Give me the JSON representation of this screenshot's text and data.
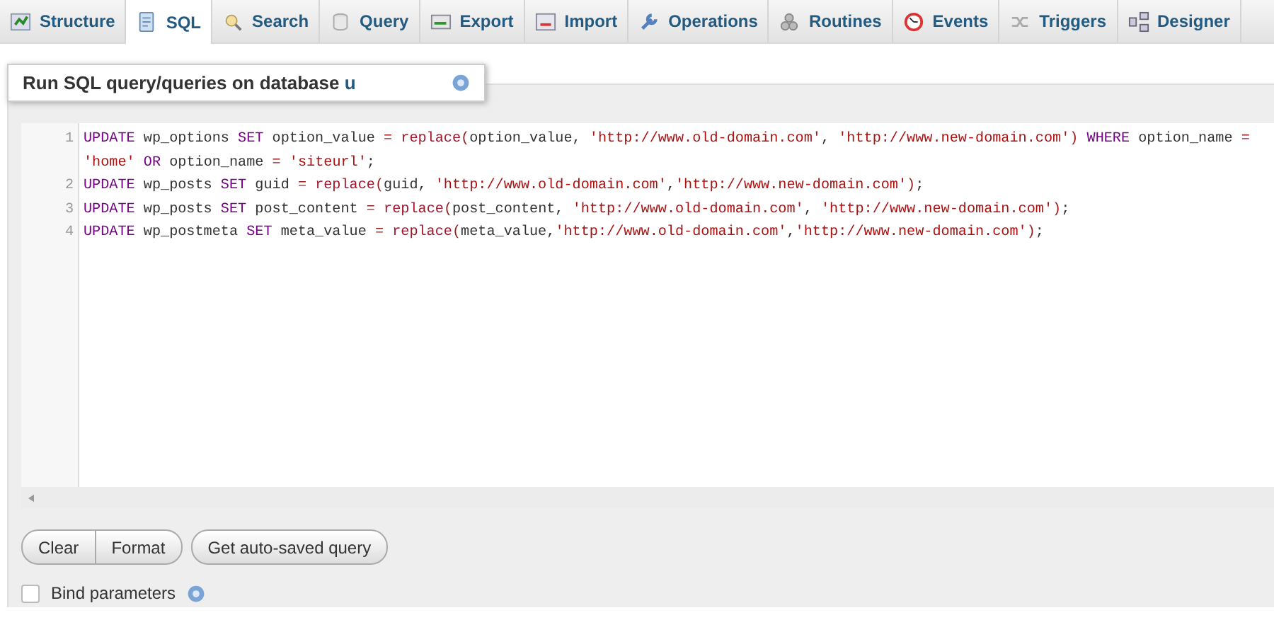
{
  "tabs": [
    {
      "label": "Structure",
      "selected": false
    },
    {
      "label": "SQL",
      "selected": true
    },
    {
      "label": "Search",
      "selected": false
    },
    {
      "label": "Query",
      "selected": false
    },
    {
      "label": "Export",
      "selected": false
    },
    {
      "label": "Import",
      "selected": false
    },
    {
      "label": "Operations",
      "selected": false
    },
    {
      "label": "Routines",
      "selected": false
    },
    {
      "label": "Events",
      "selected": false
    },
    {
      "label": "Triggers",
      "selected": false
    },
    {
      "label": "Designer",
      "selected": false
    }
  ],
  "panel": {
    "title": "Run SQL query/queries on database",
    "database": "u"
  },
  "editor": {
    "lines": [
      {
        "number": "1",
        "tokens": [
          {
            "kind": "keyword",
            "text": "UPDATE"
          },
          {
            "kind": "name",
            "text": " wp_options "
          },
          {
            "kind": "keyword",
            "text": "SET"
          },
          {
            "kind": "name",
            "text": " option_value "
          },
          {
            "kind": "operator",
            "text": "= "
          },
          {
            "kind": "function",
            "text": "replace"
          },
          {
            "kind": "operator",
            "text": "("
          },
          {
            "kind": "name",
            "text": "option_value, "
          },
          {
            "kind": "string",
            "text": "'http://www.old-domain.com'"
          },
          {
            "kind": "name",
            "text": ", "
          },
          {
            "kind": "string",
            "text": "'http://www.new-domain.com'"
          },
          {
            "kind": "operator",
            "text": ") "
          },
          {
            "kind": "keyword",
            "text": "WHERE"
          },
          {
            "kind": "name",
            "text": " option_name "
          },
          {
            "kind": "operator",
            "text": "= "
          },
          {
            "kind": "string",
            "text": "'home' "
          },
          {
            "kind": "keyword",
            "text": "OR"
          },
          {
            "kind": "name",
            "text": " option_name "
          },
          {
            "kind": "operator",
            "text": "= "
          },
          {
            "kind": "string",
            "text": "'siteurl'"
          },
          {
            "kind": "name",
            "text": ";"
          }
        ]
      },
      {
        "number": "2",
        "tokens": [
          {
            "kind": "keyword",
            "text": "UPDATE"
          },
          {
            "kind": "name",
            "text": " wp_posts "
          },
          {
            "kind": "keyword",
            "text": "SET"
          },
          {
            "kind": "name",
            "text": " guid "
          },
          {
            "kind": "operator",
            "text": "= "
          },
          {
            "kind": "function",
            "text": "replace"
          },
          {
            "kind": "operator",
            "text": "("
          },
          {
            "kind": "name",
            "text": "guid, "
          },
          {
            "kind": "string",
            "text": "'http://www.old-domain.com'"
          },
          {
            "kind": "name",
            "text": ","
          },
          {
            "kind": "string",
            "text": "'http://www.new-domain.com'"
          },
          {
            "kind": "operator",
            "text": ")"
          },
          {
            "kind": "name",
            "text": ";"
          }
        ]
      },
      {
        "number": "3",
        "tokens": [
          {
            "kind": "keyword",
            "text": "UPDATE"
          },
          {
            "kind": "name",
            "text": " wp_posts "
          },
          {
            "kind": "keyword",
            "text": "SET"
          },
          {
            "kind": "name",
            "text": " post_content "
          },
          {
            "kind": "operator",
            "text": "= "
          },
          {
            "kind": "function",
            "text": "replace"
          },
          {
            "kind": "operator",
            "text": "("
          },
          {
            "kind": "name",
            "text": "post_content, "
          },
          {
            "kind": "string",
            "text": "'http://www.old-domain.com'"
          },
          {
            "kind": "name",
            "text": ", "
          },
          {
            "kind": "string",
            "text": "'http://www.new-domain.com'"
          },
          {
            "kind": "operator",
            "text": ")"
          },
          {
            "kind": "name",
            "text": ";"
          }
        ]
      },
      {
        "number": "4",
        "tokens": [
          {
            "kind": "keyword",
            "text": "UPDATE"
          },
          {
            "kind": "name",
            "text": " wp_postmeta "
          },
          {
            "kind": "keyword",
            "text": "SET"
          },
          {
            "kind": "name",
            "text": " meta_value "
          },
          {
            "kind": "operator",
            "text": "= "
          },
          {
            "kind": "function",
            "text": "replace"
          },
          {
            "kind": "operator",
            "text": "("
          },
          {
            "kind": "name",
            "text": "meta_value,"
          },
          {
            "kind": "string",
            "text": "'http://www.old-domain.com'"
          },
          {
            "kind": "name",
            "text": ","
          },
          {
            "kind": "string",
            "text": "'http://www.new-domain.com'"
          },
          {
            "kind": "operator",
            "text": ")"
          },
          {
            "kind": "name",
            "text": ";"
          }
        ]
      }
    ]
  },
  "button_groups": [
    {
      "buttons": [
        {
          "label": "Clear"
        },
        {
          "label": "Format"
        }
      ]
    },
    {
      "buttons": [
        {
          "label": "Get auto-saved query"
        }
      ]
    }
  ],
  "bind_parameters": {
    "label": "Bind parameters",
    "checked": false
  }
}
